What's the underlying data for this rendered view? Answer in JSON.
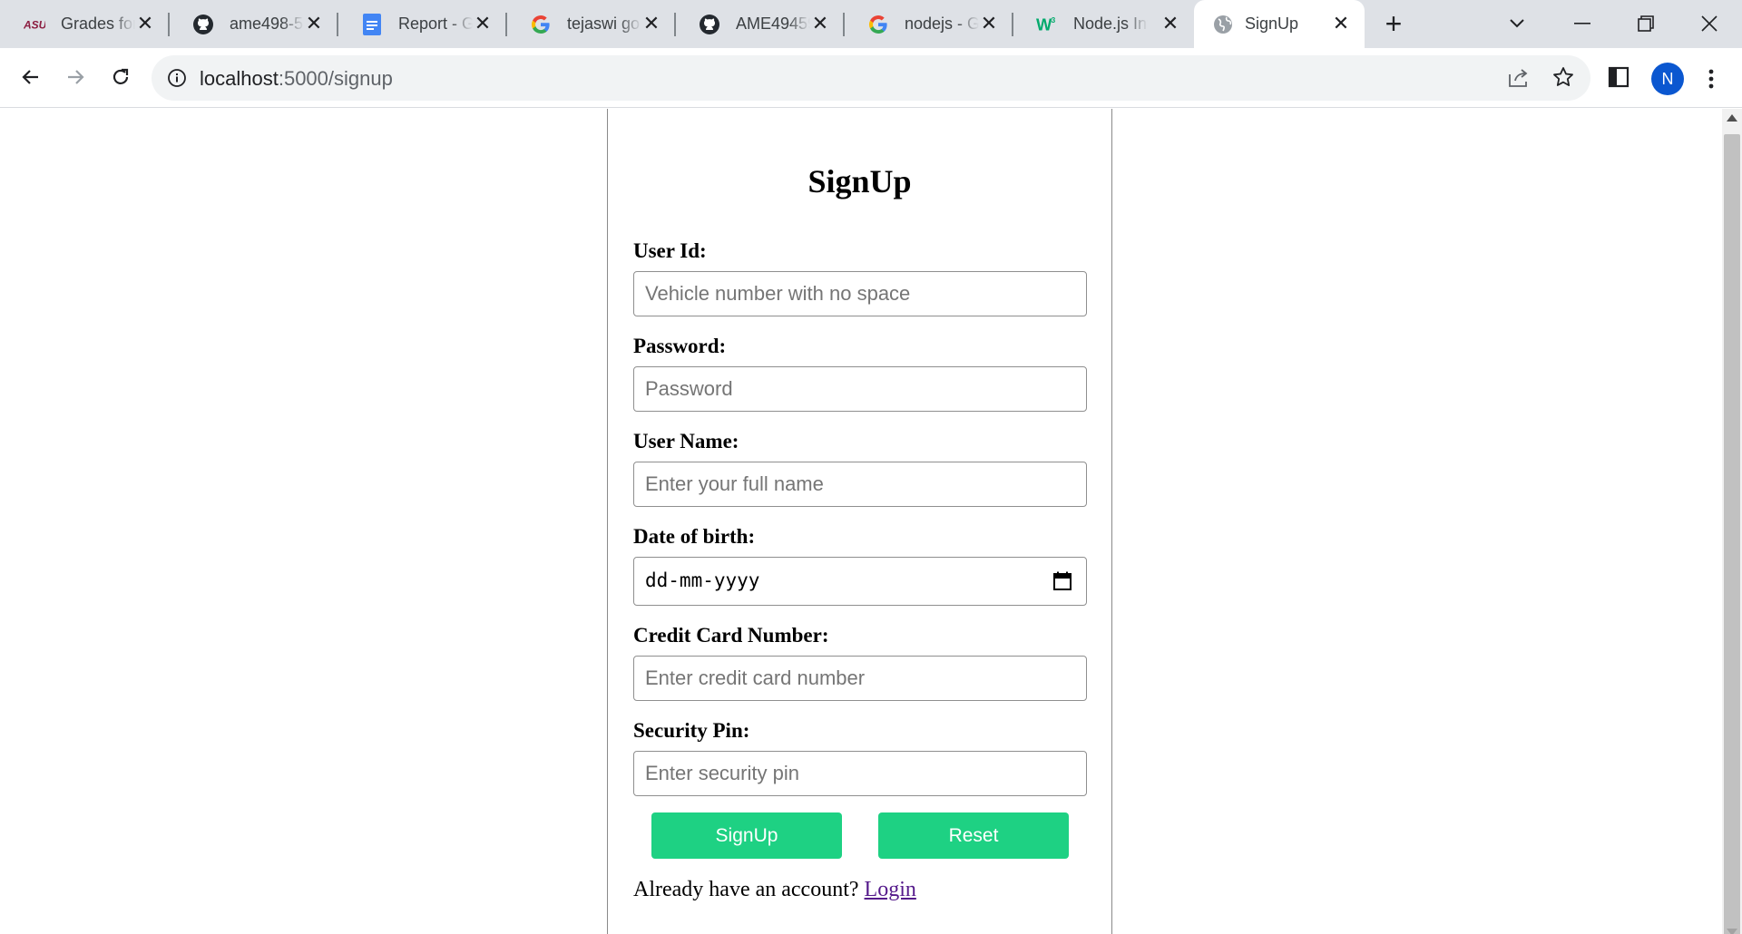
{
  "browser": {
    "tabs": [
      {
        "title": "Grades for",
        "favicon": "asu-icon",
        "active": false
      },
      {
        "title": "ame498-5",
        "favicon": "github-icon",
        "active": false
      },
      {
        "title": "Report - G",
        "favicon": "google-docs-icon",
        "active": false
      },
      {
        "title": "tejaswi go",
        "favicon": "google-icon",
        "active": false
      },
      {
        "title": "AME49459",
        "favicon": "github-icon",
        "active": false
      },
      {
        "title": "nodejs - G",
        "favicon": "google-icon",
        "active": false
      },
      {
        "title": "Node.js Int",
        "favicon": "w3schools-icon",
        "active": false
      },
      {
        "title": "SignUp",
        "favicon": "globe-icon",
        "active": true
      }
    ],
    "new_tab_label": "+",
    "address_host": "localhost",
    "address_path": ":5000/signup",
    "profile_initial": "N",
    "accent_color": "#0b57d0"
  },
  "page": {
    "heading": "SignUp",
    "fields": {
      "user_id": {
        "label": "User Id:",
        "placeholder": "Vehicle number with no space"
      },
      "password": {
        "label": "Password:",
        "placeholder": "Password"
      },
      "user_name": {
        "label": "User Name:",
        "placeholder": "Enter your full name"
      },
      "dob": {
        "label": "Date of birth:",
        "placeholder": "dd-mm-yyyy"
      },
      "credit_card": {
        "label": "Credit Card Number:",
        "placeholder": "Enter credit card number"
      },
      "security_pin": {
        "label": "Security Pin:",
        "placeholder": "Enter security pin"
      }
    },
    "buttons": {
      "signup": "SignUp",
      "reset": "Reset",
      "color": "#1ed183"
    },
    "footer": {
      "prompt": "Already have an account?",
      "link": "Login"
    }
  }
}
